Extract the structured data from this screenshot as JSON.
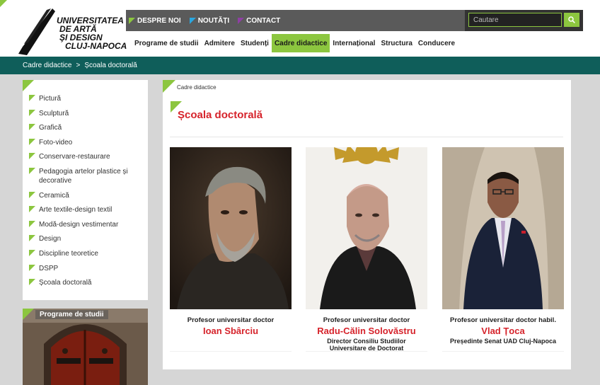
{
  "logo": {
    "line1": "UNIVERSITATEA",
    "line2": "DE ARTĂ",
    "line3": "ŞI DESIGN",
    "line4": "CLUJ-NAPOCA"
  },
  "topnav": [
    {
      "label": "DESPRE NOI",
      "accent": "#8cc63f"
    },
    {
      "label": "NOUTĂȚI",
      "accent": "#2aa7e0"
    },
    {
      "label": "CONTACT",
      "accent": "#8e3fa3"
    }
  ],
  "search": {
    "placeholder": "Cautare",
    "icon": "search-icon"
  },
  "mainnav": [
    {
      "label": "Programe de studii",
      "active": false
    },
    {
      "label": "Admitere",
      "active": false
    },
    {
      "label": "Studenți",
      "active": false
    },
    {
      "label": "Cadre didactice",
      "active": true
    },
    {
      "label": "Internațional",
      "active": false
    },
    {
      "label": "Structura",
      "active": false
    },
    {
      "label": "Conducere",
      "active": false
    }
  ],
  "breadcrumb": {
    "parent": "Cadre didactice",
    "separator": ">",
    "current": "Școala doctorală"
  },
  "sidebar": {
    "items": [
      {
        "label": "Pictură"
      },
      {
        "label": "Sculptură"
      },
      {
        "label": "Grafică"
      },
      {
        "label": "Foto-video"
      },
      {
        "label": "Conservare-restaurare"
      },
      {
        "label": "Pedagogia artelor plastice și decorative"
      },
      {
        "label": "Ceramică"
      },
      {
        "label": "Arte textile-design textil"
      },
      {
        "label": "Modă-design vestimentar"
      },
      {
        "label": "Design"
      },
      {
        "label": "Discipline teoretice"
      },
      {
        "label": "DSPP"
      },
      {
        "label": "Școala doctorală"
      }
    ],
    "programs_title": "Programe de studii"
  },
  "content": {
    "small_crumb": "Cadre didactice",
    "title": "Școala doctorală",
    "people": [
      {
        "rank": "Profesor universitar doctor",
        "name": "Ioan Sbârciu",
        "role1": "",
        "role2": ""
      },
      {
        "rank": "Profesor universitar doctor",
        "name": "Radu-Călin Solovăstru",
        "role1": "Director Consiliu Studiilor",
        "role2": "Universitare de Doctorat"
      },
      {
        "rank": "Profesor universitar doctor habil.",
        "name": "Vlad Țoca",
        "role1": "Președinte Senat UAD Cluj-Napoca",
        "role2": ""
      }
    ]
  },
  "colors": {
    "accent_green": "#8cc63f",
    "teal": "#0f5e5a",
    "title_red": "#d6232b"
  }
}
